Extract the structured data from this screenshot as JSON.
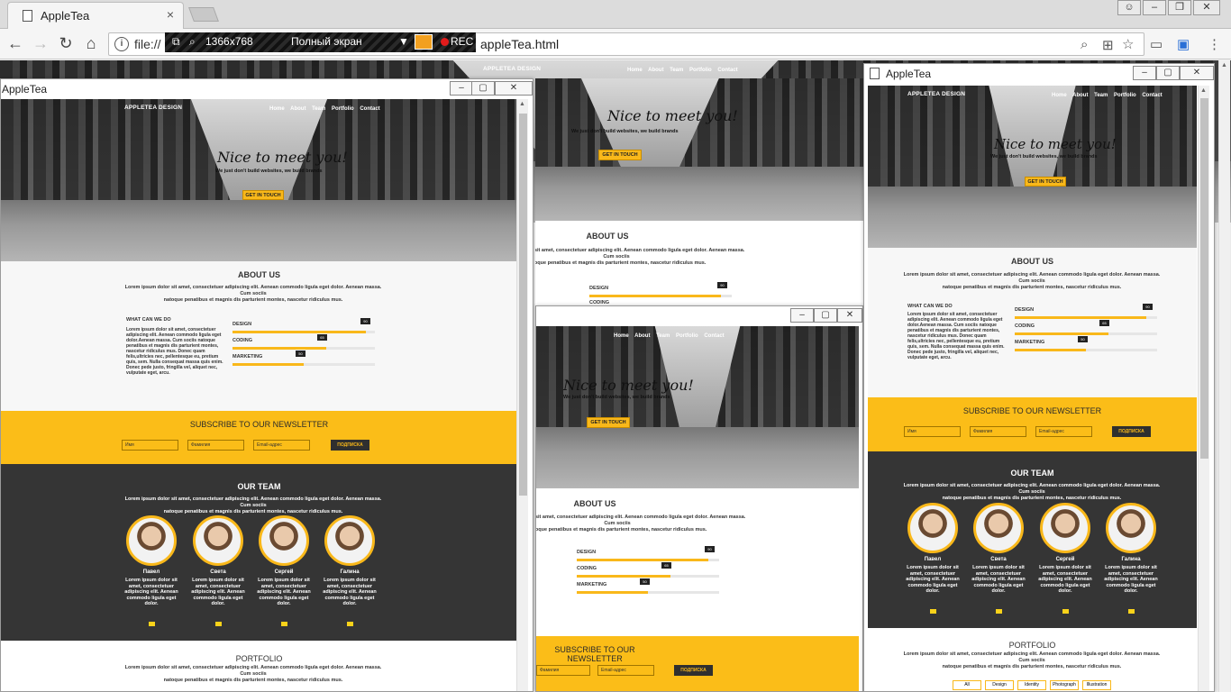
{
  "browser": {
    "tab_title": "AppleTea",
    "tab_close": "×",
    "url_prefix": "file://",
    "url_suffix": "appleTea.html",
    "info_icon": "i",
    "back": "←",
    "forward": "→",
    "reload": "↻",
    "home": "⌂",
    "window_controls": [
      "person-icon",
      "minimize-icon",
      "restore-icon",
      "close-icon"
    ]
  },
  "recorder": {
    "resolution": "1366x768",
    "mode": "Полный экран",
    "rec": "REC"
  },
  "site": {
    "brand": "APPLETEA DESIGN",
    "nav": "Home About Team Portfolio Contact",
    "headline": "Nice to meet you!",
    "tagline": "We just don't build websites, we build brands",
    "cta": "GET IN TOUCH",
    "about_title": "ABOUT US",
    "about_text_1": "Lorem ipsum dolor sit amet, consectetuer adipiscing elit. Aenean commodo ligula eget dolor. Aenean massa.",
    "about_text_2": "Cum sociis",
    "about_text_3": "natoque penatibus et magnis dis parturient montes, nascetur ridiculus mus.",
    "what_we_do": "WHAT CAN WE DO",
    "what_text": "Lorem ipsum dolor sit amet, consectetuer adipiscing elit. Aenean commodo ligula eget dolor.Aenean massa. Cum sociis natoque penatibus et magnis dis parturient montes, nascetur ridiculus mus. Donec quam felis,ultricies nec, pellentesque eu, pretium quis, sem. Nulla consequat massa quis enim. Donec pede justo, fringilla vel, aliquet nec, vulputate eget, arcu.",
    "skills": [
      {
        "label": "DESIGN",
        "value": 0.9
      },
      {
        "label": "CODING",
        "value": 0.65
      },
      {
        "label": "MARKETING",
        "value": 0.5
      }
    ],
    "newsletter_title": "SUBSCRIBE TO OUR NEWSLETTER",
    "newsletter_name": "Имя",
    "newsletter_surname": "Фамилия",
    "newsletter_email": "Email-адрес",
    "newsletter_button": "ПОДПИСКА",
    "team_title": "OUR TEAM",
    "team": [
      {
        "name": "Павел",
        "desc": "Lorem ipsum dolor sit amet, consectetuer adipiscing elit. Aenean commodo ligula eget dolor."
      },
      {
        "name": "Света",
        "desc": "Lorem ipsum dolor sit amet, consectetuer adipiscing elit. Aenean commodo ligula eget dolor."
      },
      {
        "name": "Сергей",
        "desc": "Lorem ipsum dolor sit amet, consectetuer adipiscing elit. Aenean commodo ligula eget dolor."
      },
      {
        "name": "Галина",
        "desc": "Lorem ipsum dolor sit amet, consectetuer adipiscing elit. Aenean commodo ligula eget dolor."
      }
    ],
    "portfolio_title": "PORTFOLIO",
    "portfolio_filters": [
      "All",
      "Design",
      "Identity",
      "Photograph",
      "Illustration"
    ]
  },
  "windows": {
    "left_title": "AppleTea",
    "right_title": "AppleTea"
  },
  "colors": {
    "accent": "#fbbd18",
    "dark": "#353535"
  }
}
